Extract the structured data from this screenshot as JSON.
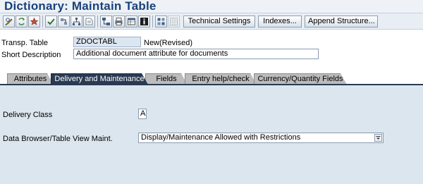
{
  "window": {
    "title": "Dictionary: Maintain Table"
  },
  "toolbar": {
    "icons": [
      "display-change-icon",
      "other-object-icon",
      "activate-icon",
      "check-icon",
      "where-used-icon",
      "hierarchy-icon",
      "object-directory-icon",
      "print-icon",
      "table-contents-icon",
      "info-icon",
      "enhancement-icon",
      "grid-icon"
    ],
    "technical_settings_label": "Technical Settings",
    "indexes_label": "Indexes...",
    "append_structure_label": "Append Structure..."
  },
  "header": {
    "transp_table_label": "Transp. Table",
    "transp_table_value": "ZDOCTABL",
    "status": "New(Revised)",
    "short_description_label": "Short Description",
    "short_description_value": "Additional document attribute for documents"
  },
  "tabs": [
    {
      "label": "Attributes",
      "active": false
    },
    {
      "label": "Delivery and Maintenance",
      "active": true
    },
    {
      "label": "Fields",
      "active": false
    },
    {
      "label": "Entry help/check",
      "active": false
    },
    {
      "label": "Currency/Quantity Fields",
      "active": false
    }
  ],
  "delivery": {
    "delivery_class_label": "Delivery Class",
    "delivery_class_value": "A",
    "browser_label": "Data Browser/Table View Maint.",
    "browser_value": "Display/Maintenance Allowed with Restrictions"
  },
  "colors": {
    "title": "#19427a",
    "active_tab": "#2a3a52",
    "content_bg": "#dce6ef"
  }
}
